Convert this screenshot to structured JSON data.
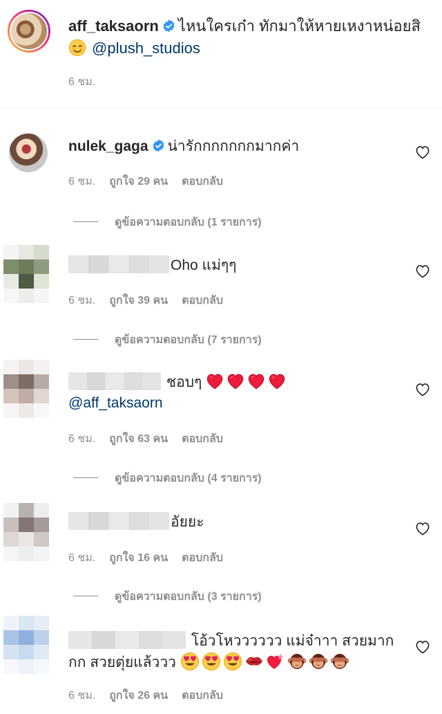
{
  "caption": {
    "username": "aff_taksaorn",
    "text": "ไหนใครเก๋า ทักมาให้หายเหงาหน่อยสิ",
    "mention": "@plush_studios",
    "time": "6 ชม.",
    "icons": [
      "verified-badge-icon",
      "smiling-face-emoji"
    ]
  },
  "comments": [
    {
      "username": "nulek_gaga",
      "text": "น่ารักกกกกกกมากค่า",
      "time": "6 ชม.",
      "likes": "ถูกใจ 29 คน",
      "reply": "ตอบกลับ",
      "view_replies": "ดูข้อความตอบกลับ (1 รายการ)"
    },
    {
      "username": "",
      "text": "Oho แม่ๆๆ",
      "time": "6 ชม.",
      "likes": "ถูกใจ 39 คน",
      "reply": "ตอบกลับ",
      "view_replies": "ดูข้อความตอบกลับ (7 รายการ)"
    },
    {
      "username": "",
      "text": "ชอบๆ",
      "text2": "@aff_taksaorn",
      "time": "6 ชม.",
      "likes": "ถูกใจ 63 คน",
      "reply": "ตอบกลับ",
      "view_replies": "ดูข้อความตอบกลับ (4 รายการ)"
    },
    {
      "username": "",
      "text": "อัยยะ",
      "time": "6 ชม.",
      "likes": "ถูกใจ 16 คน",
      "reply": "ตอบกลับ",
      "view_replies": "ดูข้อความตอบกลับ (3 รายการ)"
    },
    {
      "username": "",
      "text": "โอ้วโหวววววว แม่จ๋าาา สวยมาก",
      "text2": "กก สวยตุ่ยแล้ววว",
      "time": "6 ชม.",
      "likes": "ถูกใจ 26 คน",
      "reply": "ตอบกลับ"
    }
  ],
  "colors": {
    "text": "#262626",
    "secondary": "#8e8e8e",
    "link": "#00376b",
    "verified": "#3897f0",
    "emoji_heart": "#ed1c3a"
  }
}
